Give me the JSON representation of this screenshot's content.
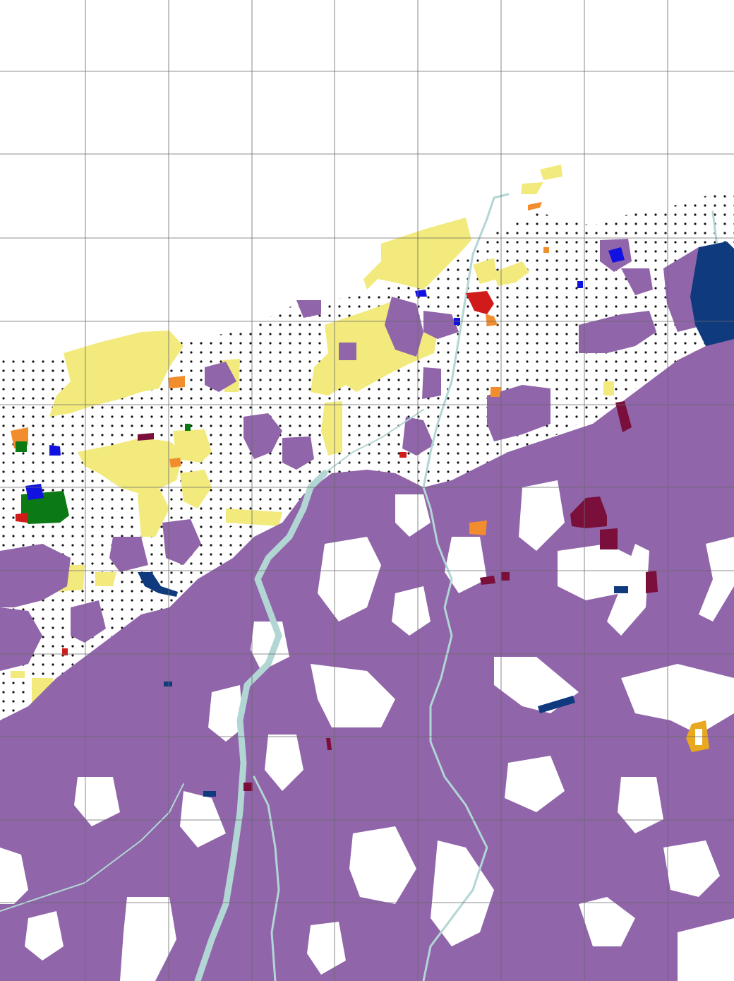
{
  "map": {
    "colors": {
      "background": "#ffffff",
      "agricultural": "#9065aa",
      "yellow_fields": "#f2ea7c",
      "orange": "#f28d2e",
      "red": "#d11a1a",
      "maroon": "#7a0f3c",
      "dark_blue": "#0f3a7e",
      "bright_blue": "#1111e0",
      "green": "#0b7a14",
      "gold": "#e8a820",
      "river": "#b2d6d4",
      "dots": "#111111",
      "grid": "#6a6a6a"
    },
    "grid": {
      "columns": 9,
      "rows": 12
    }
  }
}
